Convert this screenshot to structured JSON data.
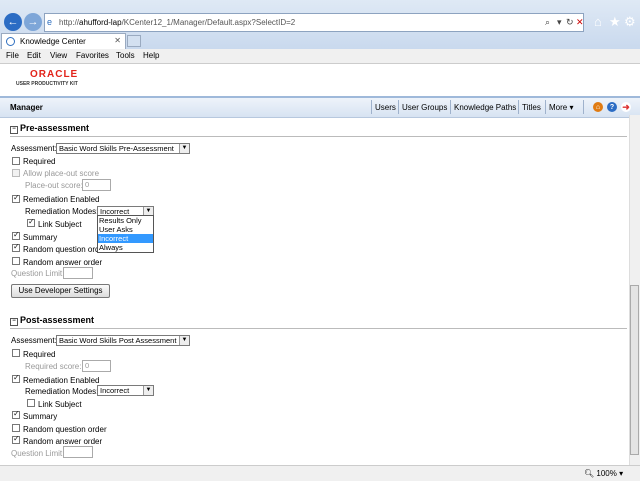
{
  "browser": {
    "url_prefix": "http://",
    "url_host": "ahufford-lap",
    "url_path": "/KCenter12_1/Manager/Default.aspx?SelectID=2",
    "tab_title": "Knowledge Center",
    "menu": [
      "File",
      "Edit",
      "View",
      "Favorites",
      "Tools",
      "Help"
    ],
    "zoom": "100%"
  },
  "header": {
    "logo_brand": "ORACLE",
    "logo_sub": "USER PRODUCTIVITY KIT",
    "title": "Manager",
    "nav": [
      "Users",
      "User Groups",
      "Knowledge Paths",
      "Titles",
      "More"
    ]
  },
  "pre": {
    "title": "Pre-assessment",
    "assessment_label": "Assessment:",
    "assessment_value": "Basic Word Skills Pre-Assessment",
    "required_label": "Required",
    "allow_label": "Allow place-out score",
    "placeout_label": "Place-out score:",
    "placeout_value": "0",
    "remediation_label": "Remediation Enabled",
    "modes_label": "Remediation Modes:",
    "modes_value": "Incorrect",
    "modes_options": [
      "Results Only",
      "User Asks",
      "Incorrect",
      "Always"
    ],
    "link_label": "Link Subject",
    "summary_label": "Summary",
    "random_q_label": "Random question order",
    "random_a_label": "Random answer order",
    "qlimit_label": "Question Limit:",
    "dev_button": "Use Developer Settings"
  },
  "post": {
    "title": "Post-assessment",
    "assessment_label": "Assessment:",
    "assessment_value": "Basic Word Skills Post Assessment",
    "required_label": "Required",
    "reqscore_label": "Required score:",
    "reqscore_value": "0",
    "remediation_label": "Remediation Enabled",
    "modes_label": "Remediation Modes:",
    "modes_value": "Incorrect",
    "link_label": "Link Subject",
    "summary_label": "Summary",
    "random_q_label": "Random question order",
    "random_a_label": "Random answer order",
    "qlimit_label": "Question Limit:"
  }
}
